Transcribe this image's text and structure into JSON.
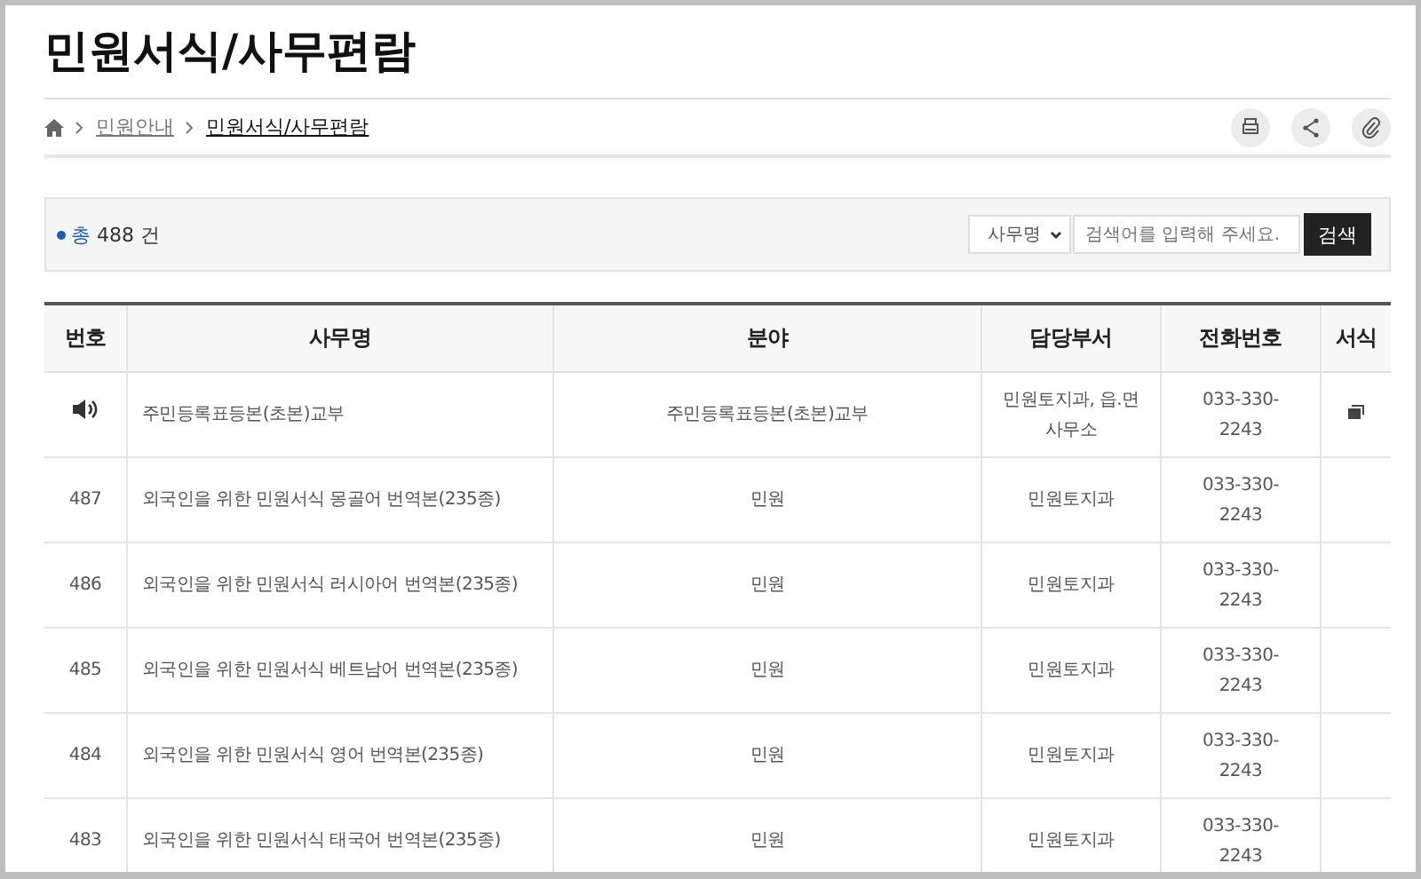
{
  "page_title": "민원서식/사무편람",
  "breadcrumb": [
    {
      "label": "민원안내",
      "current": false
    },
    {
      "label": "민원서식/사무편람",
      "current": true
    }
  ],
  "total": {
    "label": "총",
    "count": "488",
    "unit": "건"
  },
  "search": {
    "category": "사무명",
    "placeholder": "검색어를 입력해 주세요.",
    "button": "검색"
  },
  "table": {
    "columns": [
      "번호",
      "사무명",
      "분야",
      "담당부서",
      "전화번호",
      "서식"
    ],
    "rows": [
      {
        "kind": "notice",
        "name": "주민등록표등본(초본)교부",
        "field": "주민등록표등본(초본)교부",
        "dept": "민원토지과, 읍.면사무소",
        "phone": "033-330-2243",
        "has_form": true
      },
      {
        "kind": "normal",
        "number": "487",
        "name": "외국인을 위한 민원서식 몽골어 번역본(235종)",
        "field": "민원",
        "dept": "민원토지과",
        "phone": "033-330-2243",
        "has_form": false
      },
      {
        "kind": "normal",
        "number": "486",
        "name": "외국인을 위한 민원서식 러시아어 번역본(235종)",
        "field": "민원",
        "dept": "민원토지과",
        "phone": "033-330-2243",
        "has_form": false
      },
      {
        "kind": "normal",
        "number": "485",
        "name": "외국인을 위한 민원서식 베트남어 번역본(235종)",
        "field": "민원",
        "dept": "민원토지과",
        "phone": "033-330-2243",
        "has_form": false
      },
      {
        "kind": "normal",
        "number": "484",
        "name": "외국인을 위한 민원서식 영어 번역본(235종)",
        "field": "민원",
        "dept": "민원토지과",
        "phone": "033-330-2243",
        "has_form": false
      },
      {
        "kind": "normal",
        "number": "483",
        "name": "외국인을 위한 민원서식 태국어 번역본(235종)",
        "field": "민원",
        "dept": "민원토지과",
        "phone": "033-330-2243",
        "has_form": false
      }
    ]
  }
}
